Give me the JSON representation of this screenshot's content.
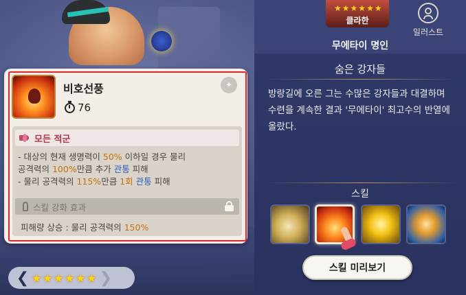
{
  "skill_card": {
    "name": "비호선풍",
    "cooldown": "76",
    "target": "모든 적군",
    "desc_line1_a": "- 대상의 현재 생명력이 ",
    "desc_line1_b": "50%",
    "desc_line1_c": " 이하일 경우 물리",
    "desc_line2_a": "공격력의 ",
    "desc_line2_b": "100%",
    "desc_line2_c": "만큼 추가 ",
    "desc_line2_d": "관통",
    "desc_line2_e": " 피해",
    "desc_line3_a": "- 물리 공격력의 ",
    "desc_line3_b": "115%",
    "desc_line3_c": "만큼 ",
    "desc_line3_d": "1회",
    "desc_line3_e": " ",
    "desc_line3_f": "관통",
    "desc_line3_g": " 피해",
    "enhance_label": "스킬 강화 효과",
    "enhance_desc_a": "피해량 상승 : 물리 공격력의 ",
    "enhance_desc_b": "150%"
  },
  "star_selector": {
    "stars": 6,
    "left_arrow": "❮",
    "right_arrow": "❯"
  },
  "right_panel": {
    "club_name": "클라한",
    "illustration_label": "일러스트",
    "title": "무에타이 명인",
    "lore_title": "숨은 강자들",
    "lore_text": "방랑길에 오른 그는 수많은 강자들과 대결하며 수련을 계속한 결과 '무에타이' 최고수의 반열에 올랐다.",
    "skill_section_title": "스킬",
    "preview_button": "스킬 미리보기"
  },
  "colors": {
    "highlight": "#c4700d",
    "pierce": "#2b5cb8",
    "target": "#b3344b",
    "selection_border": "#e0252b"
  }
}
